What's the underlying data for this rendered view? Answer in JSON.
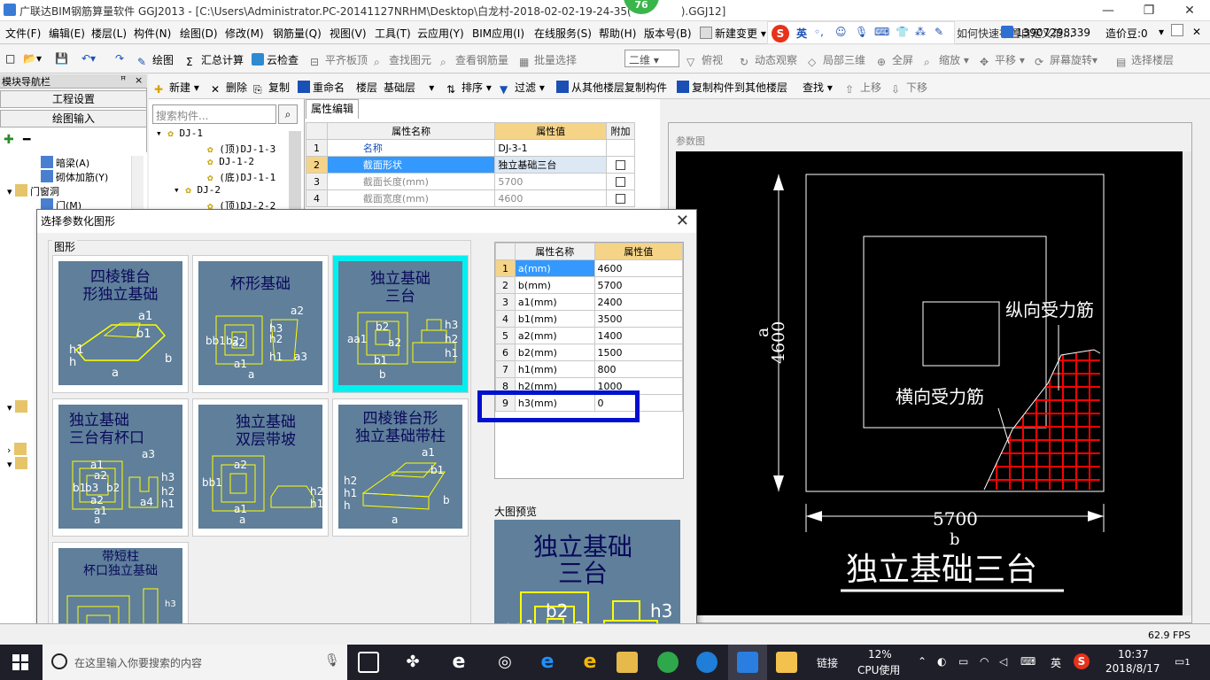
{
  "window": {
    "title": "广联达BIM钢筋算量软件 GGJ2013 - [C:\\Users\\Administrator.PC-20141127NRHM\\Desktop\\白龙村-2018-02-02-19-24-35(",
    "title_tail": ").GGJ12]",
    "badge": "76"
  },
  "menu": [
    "文件(F)",
    "编辑(E)",
    "楼层(L)",
    "构件(N)",
    "绘图(D)",
    "修改(M)",
    "钢筋量(Q)",
    "视图(V)",
    "工具(T)",
    "云应用(Y)",
    "BIM应用(I)",
    "在线服务(S)",
    "帮助(H)",
    "版本号(B)",
    "新建变更",
    "如何快速布置自定义范...",
    "13907298339",
    "造价豆:0"
  ],
  "ime": {
    "lang": "英"
  },
  "toolbar1": {
    "draw": "绘图",
    "sum": "汇总计算",
    "cloudcheck": "云检查",
    "flatboard": "平齐板顶",
    "findelem": "查找图元",
    "viewrebar": "查看钢筋量",
    "batchselect": "批量选择",
    "view2d": "二维",
    "topview": "俯视",
    "dynview": "动态观察",
    "local3d": "局部三维",
    "fullscreen": "全屏",
    "zoom": "缩放",
    "pan": "平移",
    "rotate": "屏幕旋转",
    "selectfloor": "选择楼层"
  },
  "toolbar2": {
    "new": "新建",
    "delete": "删除",
    "copy": "复制",
    "rename": "重命名",
    "floor": "楼层",
    "floorval": "基础层",
    "sort": "排序",
    "filter": "过滤",
    "copyfrom": "从其他楼层复制构件",
    "copyto": "复制构件到其他楼层",
    "find": "查找",
    "up": "上移",
    "down": "下移"
  },
  "nav": {
    "header": "模块导航栏",
    "pin": "ꟸ",
    "close": "×",
    "btn1": "工程设置",
    "btn2": "绘图输入",
    "items": [
      "暗梁(A)",
      "砌体加筋(Y)",
      "门窗洞",
      "门(M)"
    ]
  },
  "components": {
    "search_placeholder": "搜索构件...",
    "items": [
      "DJ-1",
      "(顶)DJ-1-3",
      "DJ-1-2",
      "(底)DJ-1-1",
      "DJ-2",
      "(顶)DJ-2-2"
    ]
  },
  "propedit": {
    "tab": "属性编辑",
    "cols": [
      "属性名称",
      "属性值",
      "附加"
    ],
    "rows": [
      {
        "n": "1",
        "name": "名称",
        "val": "DJ-3-1"
      },
      {
        "n": "2",
        "name": "截面形状",
        "val": "独立基础三台"
      },
      {
        "n": "3",
        "name": "截面长度(mm)",
        "val": "5700"
      },
      {
        "n": "4",
        "name": "截面宽度(mm)",
        "val": "4600"
      }
    ]
  },
  "param": {
    "label": "参数图",
    "dim_a": "a",
    "dim_a_val": "4600",
    "dim_b": "b",
    "dim_b_val": "5700",
    "rebar_long": "纵向受力筋",
    "rebar_trans": "横向受力筋",
    "caption": "独立基础三台"
  },
  "dialog": {
    "title": "选择参数化图形",
    "group": "图形",
    "tiles": [
      {
        "id": "t1",
        "title": "四棱锥台\n形独立基础"
      },
      {
        "id": "t2",
        "title": "杯形基础"
      },
      {
        "id": "t3",
        "title": "独立基础\n三台"
      },
      {
        "id": "t4",
        "title": "独立基础\n三台有杯口"
      },
      {
        "id": "t5",
        "title": "独立基础\n双层带坡"
      },
      {
        "id": "t6",
        "title": "四棱锥台形\n独立基础带柱"
      },
      {
        "id": "t7",
        "title": "带短柱\n杯口独立基础"
      }
    ],
    "cols": [
      "属性名称",
      "属性值"
    ],
    "rows": [
      {
        "n": "1",
        "name": "a(mm)",
        "val": "4600"
      },
      {
        "n": "2",
        "name": "b(mm)",
        "val": "5700"
      },
      {
        "n": "3",
        "name": "a1(mm)",
        "val": "2400"
      },
      {
        "n": "4",
        "name": "b1(mm)",
        "val": "3500"
      },
      {
        "n": "5",
        "name": "a2(mm)",
        "val": "1400"
      },
      {
        "n": "6",
        "name": "b2(mm)",
        "val": "1500"
      },
      {
        "n": "7",
        "name": "h1(mm)",
        "val": "800"
      },
      {
        "n": "8",
        "name": "h2(mm)",
        "val": "1000"
      },
      {
        "n": "9",
        "name": "h3(mm)",
        "val": "0"
      }
    ],
    "preview_label": "大图预览",
    "preview_title": "独立基础\n三台"
  },
  "status": {
    "fps": "62.9 FPS"
  },
  "taskbar": {
    "search": "在这里输入你要搜索的内容",
    "link": "链接",
    "cpu_pct": "12%",
    "cpu_label": "CPU使用",
    "lang": "英",
    "time": "10:37",
    "date": "2018/8/17",
    "notif": "1"
  },
  "colors": {
    "accent": "#3399ff",
    "header_val": "#f5d488",
    "canvas": "#000000",
    "tile_bg": "#5f7f9a",
    "highlight": "#0010d0"
  }
}
